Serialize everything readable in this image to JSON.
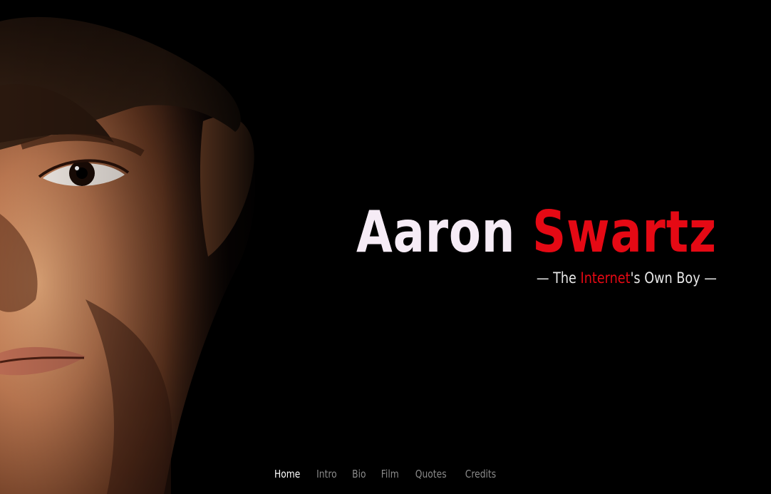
{
  "hero": {
    "name_first": "Aaron",
    "name_last": "Swartz",
    "tagline_prefix": "— The ",
    "tagline_highlight": "Internet",
    "tagline_suffix": "'s Own Boy —"
  },
  "nav": {
    "items": [
      {
        "label": "Home",
        "active": true
      },
      {
        "label": "Intro",
        "active": false
      },
      {
        "label": "Bio",
        "active": false
      },
      {
        "label": "Film",
        "active": false
      },
      {
        "label": "Quotes",
        "active": false
      },
      {
        "label": "Credits",
        "active": false
      }
    ]
  },
  "colors": {
    "background": "#000000",
    "accent": "#e50914",
    "title": "#f6ecf6",
    "nav_inactive": "#8a8a8a",
    "nav_active": "#ffffff"
  }
}
